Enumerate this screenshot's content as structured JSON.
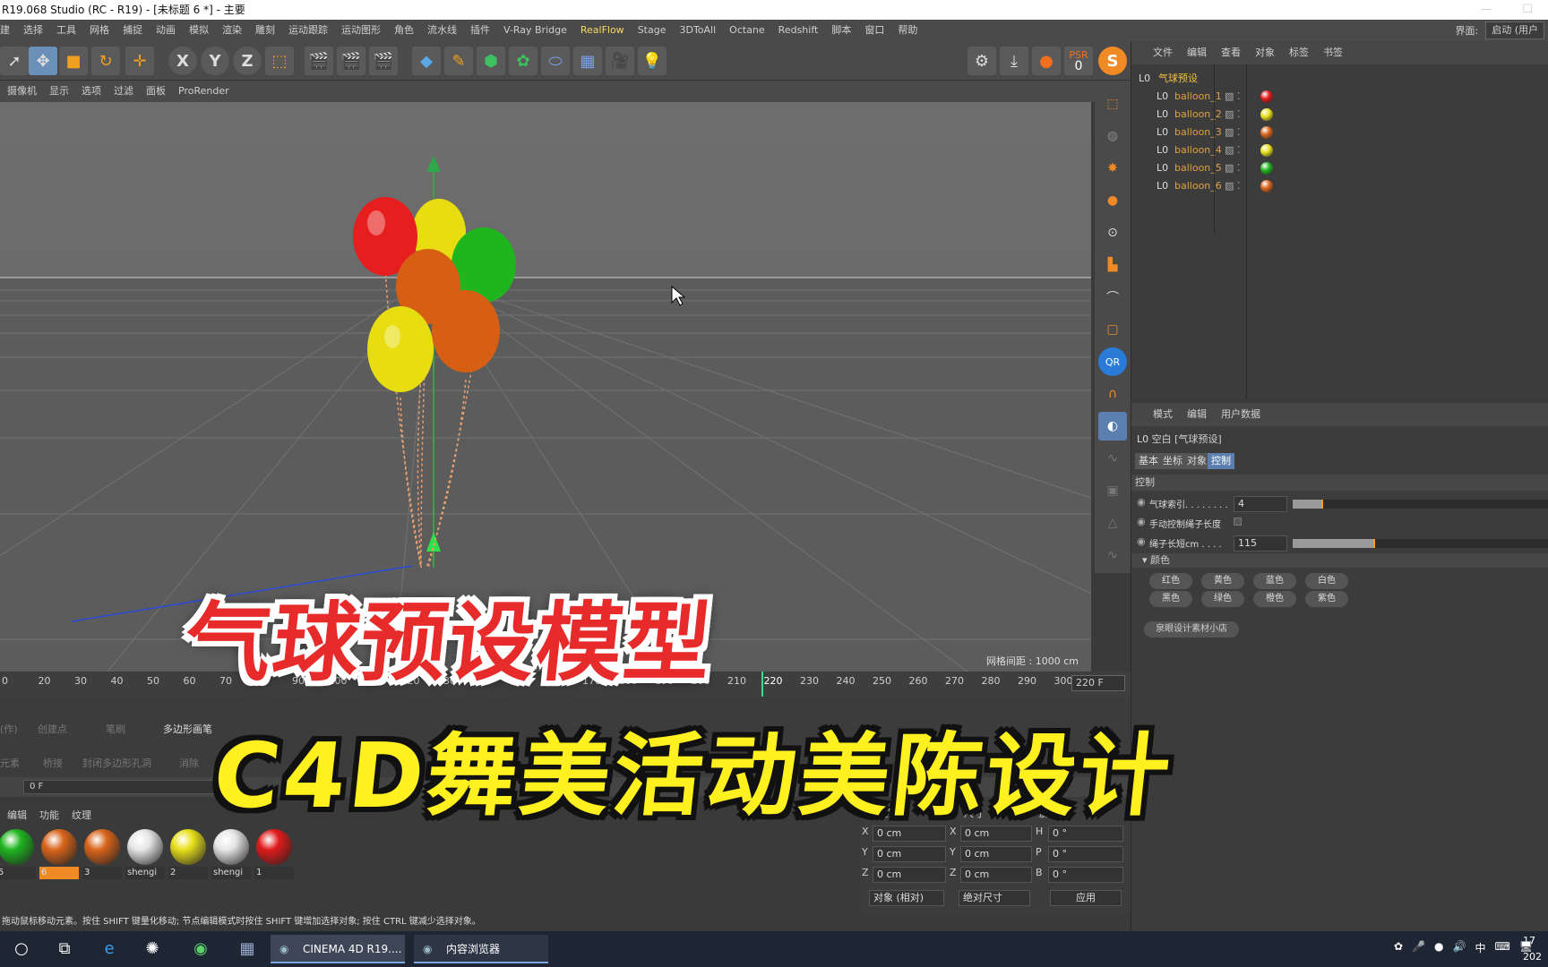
{
  "window": {
    "title": "R19.068 Studio (RC - R19) - [未标题 6 *] - 主要"
  },
  "menu": [
    "建",
    "选择",
    "工具",
    "网格",
    "捕捉",
    "动画",
    "模拟",
    "渲染",
    "雕刻",
    "运动跟踪",
    "运动图形",
    "角色",
    "流水线",
    "插件",
    "V-Ray Bridge",
    "RealFlow",
    "Stage",
    "3DToAll",
    "Octane",
    "Redshift",
    "脚本",
    "窗口",
    "帮助"
  ],
  "interface": {
    "label": "界面:",
    "value": "启动 (用户"
  },
  "toolbar": {
    "axis_x": "X",
    "axis_y": "Y",
    "axis_z": "Z",
    "psr_label": "PSR",
    "psr_value": "0"
  },
  "viewport": {
    "menu": [
      "摄像机",
      "显示",
      "选项",
      "过滤",
      "面板",
      "ProRender"
    ],
    "grid_label": "网格间距 : 1000 cm"
  },
  "timeline": {
    "ticks": [
      "0",
      "20",
      "30",
      "40",
      "50",
      "60",
      "70",
      "80",
      "90",
      "100",
      "110",
      "120",
      "130",
      "140",
      "150",
      "160",
      "170",
      "180",
      "190",
      "200",
      "210",
      "220",
      "230",
      "240",
      "250",
      "260",
      "270",
      "280",
      "290",
      "300"
    ],
    "current": "220",
    "frame_field": "220 F"
  },
  "lower_tools": {
    "items": [
      "(作)",
      "创建点",
      "笔刷",
      "多边形画笔",
      "元素",
      "桥接",
      "封闭多边形孔洞",
      "消除"
    ]
  },
  "framebar": {
    "value": "0 F"
  },
  "materials": {
    "menu": [
      "编辑",
      "功能",
      "纹理"
    ],
    "items": [
      {
        "label": "5",
        "color": "#1fb51f"
      },
      {
        "label": "6",
        "color": "#d9641a"
      },
      {
        "label": "3",
        "color": "#d9641a"
      },
      {
        "label": "shengi",
        "color": "#e6e6e6"
      },
      {
        "label": "2",
        "color": "#e8e01a"
      },
      {
        "label": "shengi",
        "color": "#e6e6e6"
      },
      {
        "label": "1",
        "color": "#e01a1a"
      }
    ]
  },
  "coords": {
    "headers": {
      "pos": "位置",
      "size": "尺寸",
      "rot": "旋转"
    },
    "rows": [
      {
        "a": "X",
        "pos": "0 cm",
        "b": "X",
        "size": "0 cm",
        "c": "H",
        "rot": "0 °"
      },
      {
        "a": "Y",
        "pos": "0 cm",
        "b": "Y",
        "size": "0 cm",
        "c": "P",
        "rot": "0 °"
      },
      {
        "a": "Z",
        "pos": "0 cm",
        "b": "Z",
        "size": "0 cm",
        "c": "B",
        "rot": "0 °"
      }
    ],
    "mode": "对象 (相对)",
    "size_mode": "绝对尺寸",
    "apply": "应用"
  },
  "status": "拖动鼠标移动元素。按住 SHIFT 键量化移动; 节点编辑模式时按住 SHIFT 键增加选择对象; 按住 CTRL 键减少选择对象。",
  "objects": {
    "menu": [
      "文件",
      "编辑",
      "查看",
      "对象",
      "标签",
      "书签"
    ],
    "root": "气球预设",
    "children": [
      {
        "name": "balloon_1",
        "color": "#e01a1a"
      },
      {
        "name": "balloon_2",
        "color": "#e8e01a"
      },
      {
        "name": "balloon_3",
        "color": "#d9641a"
      },
      {
        "name": "balloon_4",
        "color": "#e8e01a"
      },
      {
        "name": "balloon_5",
        "color": "#1fb51f"
      },
      {
        "name": "balloon_6",
        "color": "#d9641a"
      }
    ]
  },
  "attributes": {
    "menu": [
      "模式",
      "编辑",
      "用户数据"
    ],
    "object_title": "空白 [气球预设]",
    "tabs": [
      "基本",
      "坐标",
      "对象",
      "控制"
    ],
    "section": "控制",
    "params": [
      {
        "label": "气球索引. . . . . . . .",
        "value": "4",
        "fill": 0.12
      },
      {
        "label": "手动控制绳子长度",
        "value": ""
      },
      {
        "label": "绳子长短cm . . . .",
        "value": "115",
        "fill": 0.32
      }
    ],
    "color_section": "颜色",
    "colors": [
      "红色",
      "黄色",
      "蓝色",
      "白色",
      "黑色",
      "绿色",
      "橙色",
      "紫色"
    ],
    "shop_button": "泉眼设计素材小店"
  },
  "taskbar": {
    "tasks": [
      "CINEMA 4D R19....",
      "内容浏览器"
    ],
    "clock": "17",
    "date": "202"
  },
  "overlay": {
    "line1": "气球预设模型",
    "line2": "C4D舞美活动美陈设计"
  }
}
